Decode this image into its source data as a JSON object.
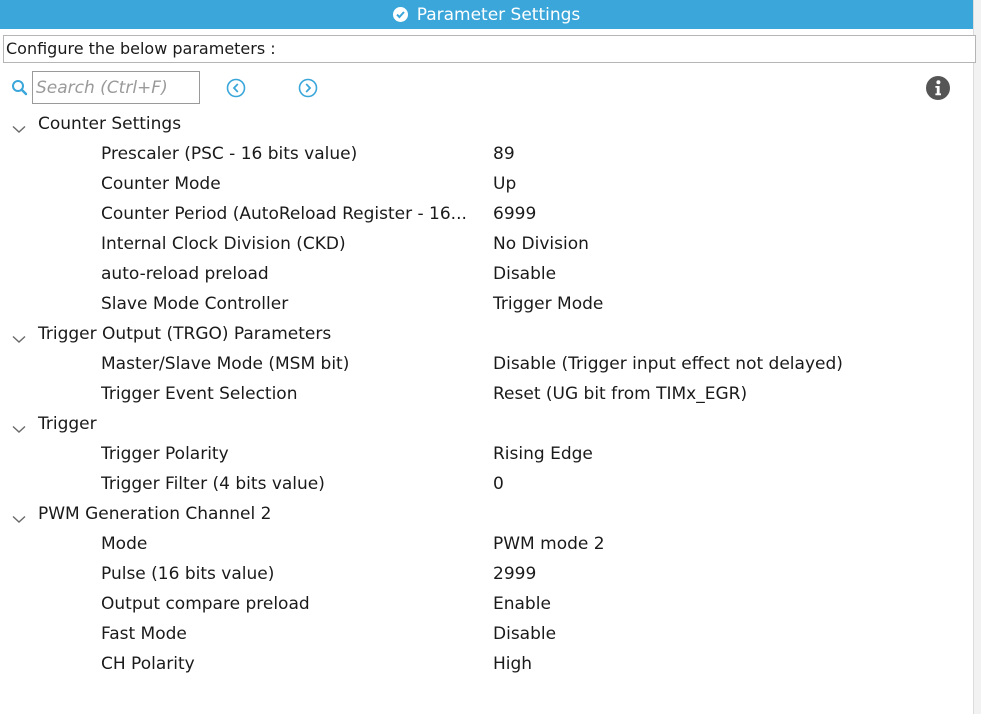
{
  "header": {
    "title": "Parameter Settings",
    "icon": "check-circle-icon",
    "bg_color": "#3aa6da"
  },
  "configure_label": "Configure the below parameters :",
  "toolbar": {
    "search_placeholder": "Search (Ctrl+F)",
    "search_value": "",
    "prev_icon": "chevron-left-circle-icon",
    "next_icon": "chevron-right-circle-icon",
    "info_icon": "info-icon"
  },
  "groups": [
    {
      "label": "Counter Settings",
      "expanded": true,
      "params": [
        {
          "name": "Prescaler (PSC - 16 bits value)",
          "value": "89"
        },
        {
          "name": "Counter Mode",
          "value": "Up"
        },
        {
          "name": "Counter Period (AutoReload Register - 16...",
          "value": "6999"
        },
        {
          "name": "Internal Clock Division (CKD)",
          "value": "No Division"
        },
        {
          "name": "auto-reload preload",
          "value": "Disable"
        },
        {
          "name": "Slave Mode Controller",
          "value": "Trigger Mode"
        }
      ]
    },
    {
      "label": "Trigger Output (TRGO) Parameters",
      "expanded": true,
      "params": [
        {
          "name": "Master/Slave Mode (MSM bit)",
          "value": "Disable (Trigger input effect not delayed)"
        },
        {
          "name": "Trigger Event Selection",
          "value": "Reset (UG bit from TIMx_EGR)"
        }
      ]
    },
    {
      "label": "Trigger",
      "expanded": true,
      "params": [
        {
          "name": "Trigger Polarity",
          "value": "Rising Edge"
        },
        {
          "name": "Trigger Filter (4 bits value)",
          "value": "0"
        }
      ]
    },
    {
      "label": "PWM Generation Channel 2",
      "expanded": true,
      "params": [
        {
          "name": "Mode",
          "value": "PWM mode 2"
        },
        {
          "name": "Pulse (16 bits value)",
          "value": "2999"
        },
        {
          "name": "Output compare preload",
          "value": "Enable"
        },
        {
          "name": "Fast Mode",
          "value": "Disable"
        },
        {
          "name": "CH Polarity",
          "value": "High"
        }
      ]
    }
  ]
}
